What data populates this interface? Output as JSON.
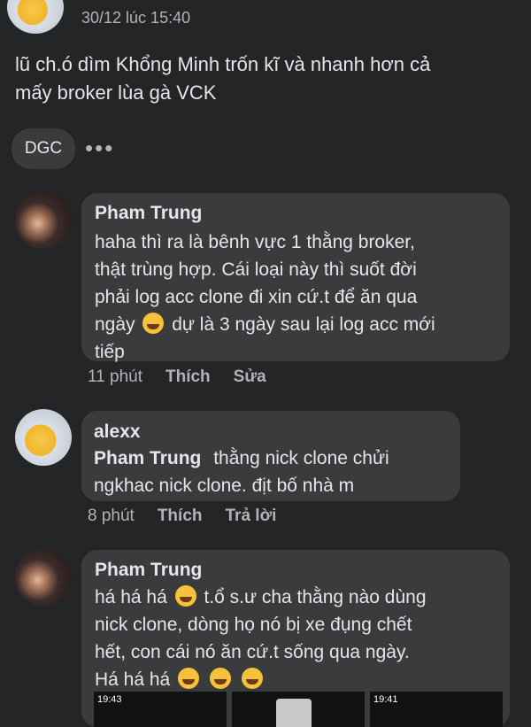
{
  "post": {
    "timestamp": "30/12 lúc 15:40",
    "text_line1": "lũ ch.ó dìm Khổng Minh trốn kĩ và nhanh hơn cả",
    "text_line2": "mấy broker lùa gà VCK",
    "tag": "DGC",
    "more_icon": "more-dots-icon"
  },
  "comments": [
    {
      "name": "Pham Trung",
      "lines": [
        "haha thì ra là bênh vực 1 thằng broker,",
        "thật trùng hợp. Cái loại này thì suốt đời",
        "phải log acc clone đi xin cứ.t để ăn qua"
      ],
      "line4_a": "ngày",
      "line4_b": "dự là 3 ngày sau lại log acc mới",
      "line5": "tiếp",
      "time": "11 phút",
      "like": "Thích",
      "action": "Sửa"
    },
    {
      "name": "alexx",
      "reply_to": "Pham Trung",
      "line1": "thằng nick clone chửi",
      "line2": "ngkhac nick clone. địt bố nhà m",
      "time": "8 phút",
      "like": "Thích",
      "action": "Trả lời"
    },
    {
      "name": "Pham Trung",
      "line1_a": "há há há",
      "line1_b": "t.ổ s.ư cha thằng nào dùng",
      "line2": "nick clone, dòng họ nó bị xe đụng chết",
      "line3": "hết, con cái nó ăn cứ.t sống qua ngày.",
      "line4": "Há há há",
      "preview_time_1": "19:43",
      "preview_time_2": "19:41"
    }
  ],
  "colors": {
    "background": "#242526",
    "bubble": "#3a3b3c",
    "text": "#e4e6eb",
    "muted": "#b0b3b8"
  }
}
